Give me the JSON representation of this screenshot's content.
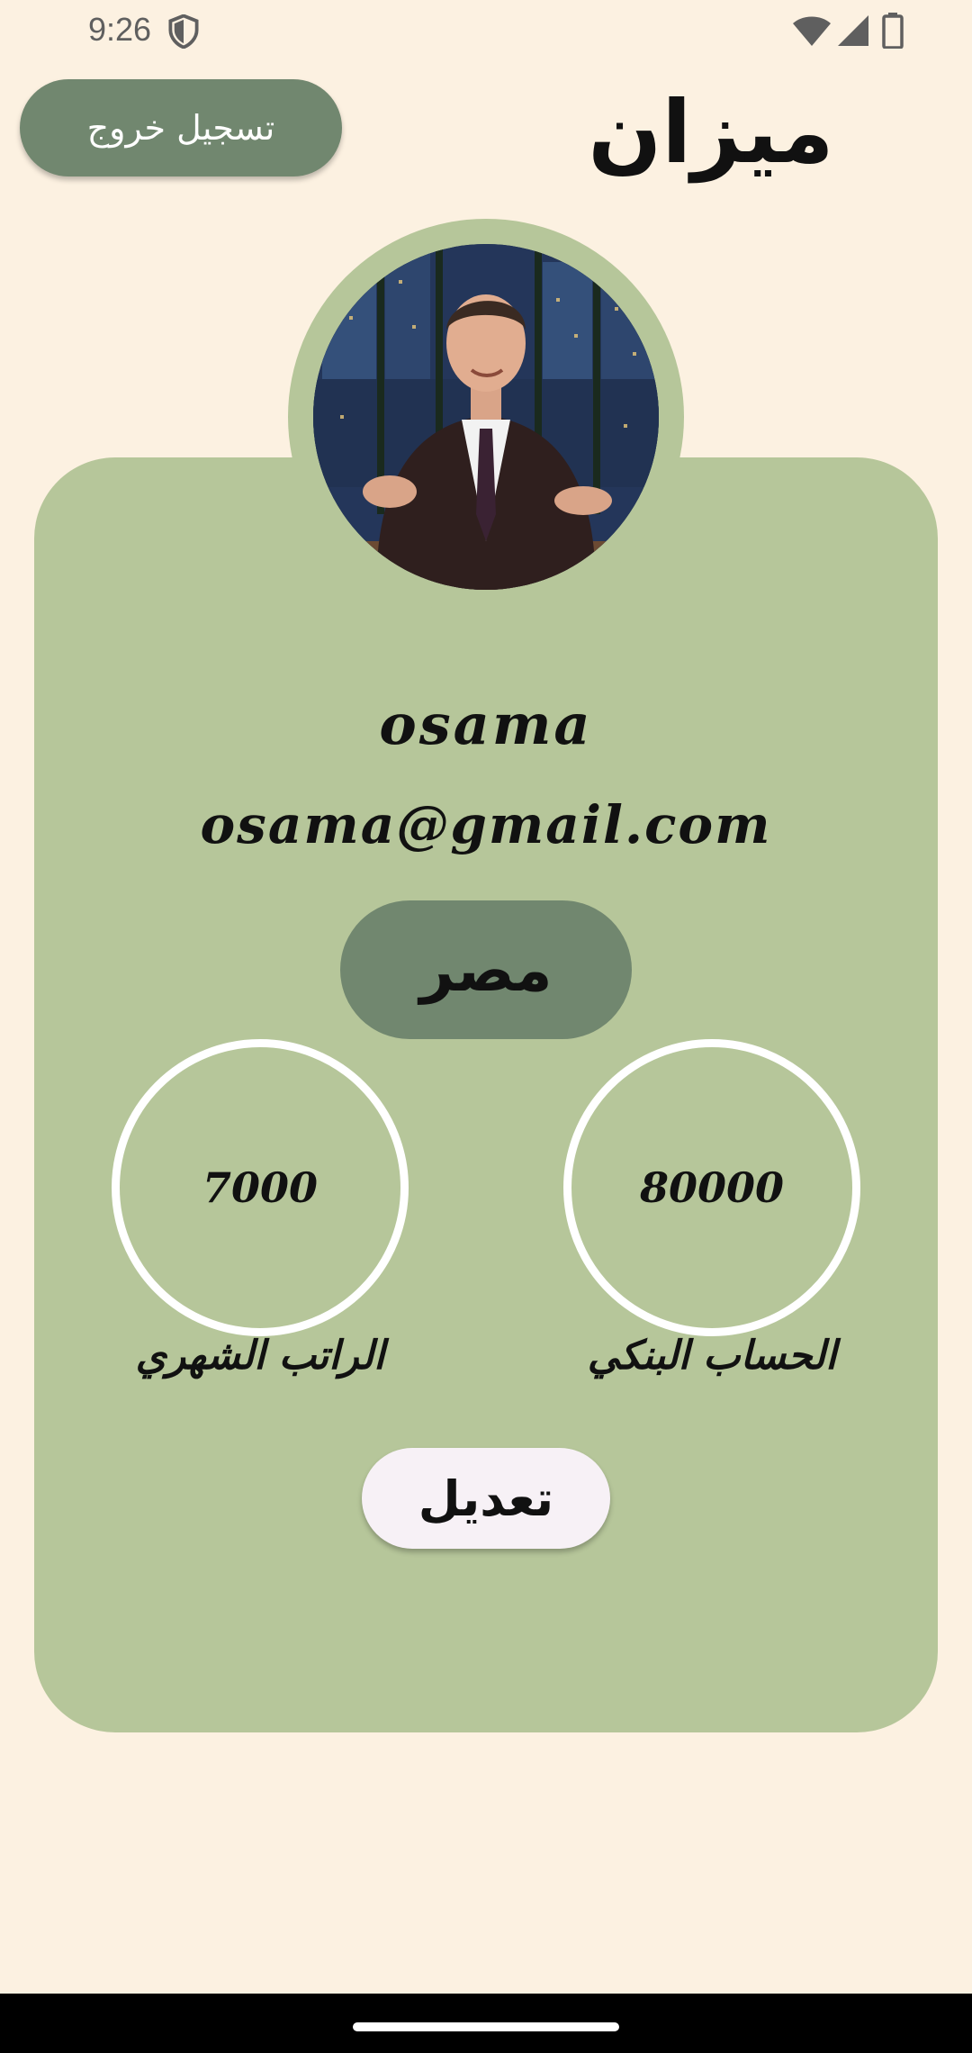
{
  "status_bar": {
    "time": "9:26",
    "icons": [
      "shield-icon",
      "wifi-icon",
      "signal-icon",
      "battery-icon"
    ]
  },
  "header": {
    "app_title": "ميزان",
    "logout_label": "تسجيل خروج"
  },
  "profile": {
    "name": "osama",
    "email": "osama@gmail.com",
    "country": "مصر",
    "monthly_salary": {
      "value": "7000",
      "label": "الراتب الشهري"
    },
    "bank_account": {
      "value": "80000",
      "label": "الحساب البنكي"
    },
    "edit_label": "تعديل"
  },
  "colors": {
    "background": "#fcf1e1",
    "card": "#b6c69a",
    "accent": "#71876f",
    "edit_button": "#f7f1f6"
  }
}
